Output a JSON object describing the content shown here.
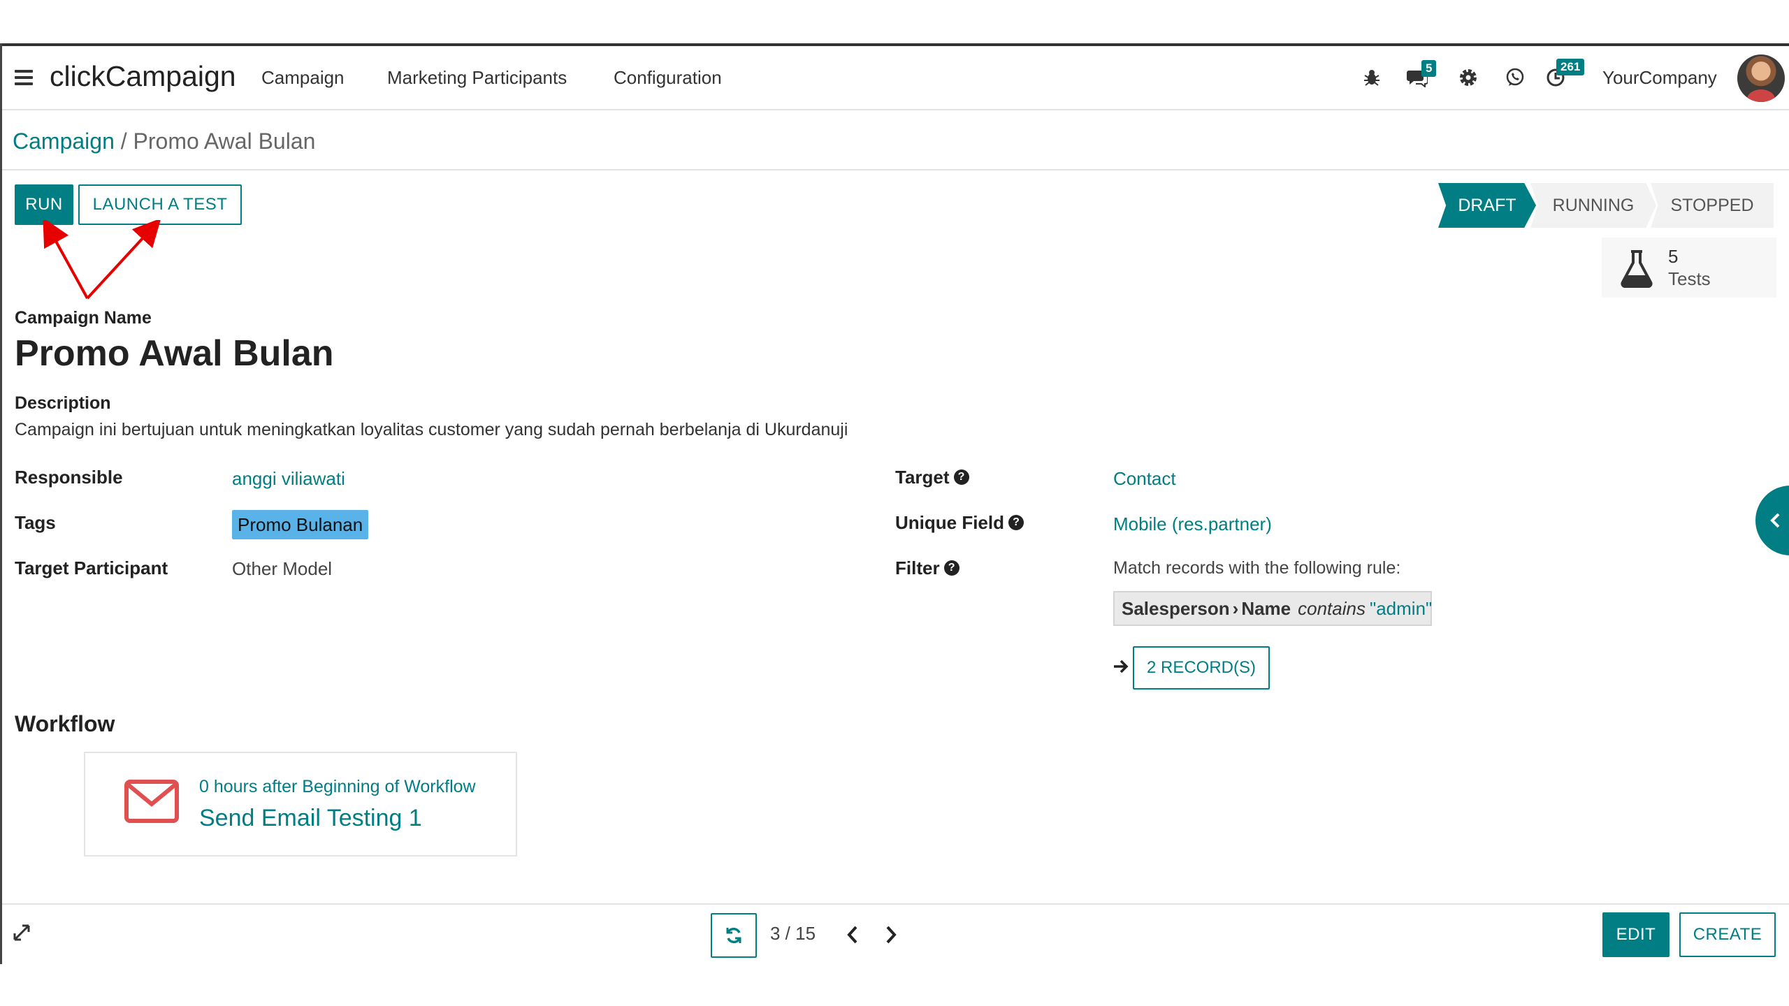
{
  "app": {
    "name": "clickCampaign",
    "menu": [
      "Campaign",
      "Marketing Participants",
      "Configuration"
    ],
    "messages_badge": "5",
    "activities_badge": "261",
    "company": "YourCompany"
  },
  "breadcrumb": {
    "parent": "Campaign",
    "separator": "/",
    "current": "Promo Awal Bulan"
  },
  "actions": {
    "run": "RUN",
    "launch_test": "LAUNCH A TEST"
  },
  "statusbar": {
    "stages": [
      "DRAFT",
      "RUNNING",
      "STOPPED"
    ],
    "active": "DRAFT"
  },
  "smart_button": {
    "count": "5",
    "label": "Tests",
    "icon": "flask-icon"
  },
  "form": {
    "name_label": "Campaign Name",
    "name": "Promo Awal Bulan",
    "description_label": "Description",
    "description": "Campaign ini bertujuan untuk meningkatkan loyalitas customer yang sudah pernah berbelanja di Ukurdanuji",
    "responsible_label": "Responsible",
    "responsible": "anggi viliawati",
    "tags_label": "Tags",
    "tag": "Promo Bulanan",
    "target_participant_label": "Target Participant",
    "target_participant": "Other Model",
    "target_label": "Target",
    "target": "Contact",
    "unique_field_label": "Unique Field",
    "unique_field": "Mobile (res.partner)",
    "filter_label": "Filter",
    "filter_intro": "Match records with the following rule:",
    "filter_field": "Salesperson",
    "filter_subfield": "Name",
    "filter_operator": "contains",
    "filter_value": "\"admin\"",
    "records_button": "2 RECORD(S)"
  },
  "workflow": {
    "title": "Workflow",
    "activity": {
      "trigger": "0 hours after Beginning of Workflow",
      "name": "Send Email Testing 1"
    }
  },
  "footer": {
    "pager": "3 / 15",
    "edit": "EDIT",
    "create": "CREATE"
  },
  "colors": {
    "primary": "#017e84",
    "tag": "#5ab3e8",
    "annotation": "#e60000",
    "mail_icon": "#e05050"
  }
}
